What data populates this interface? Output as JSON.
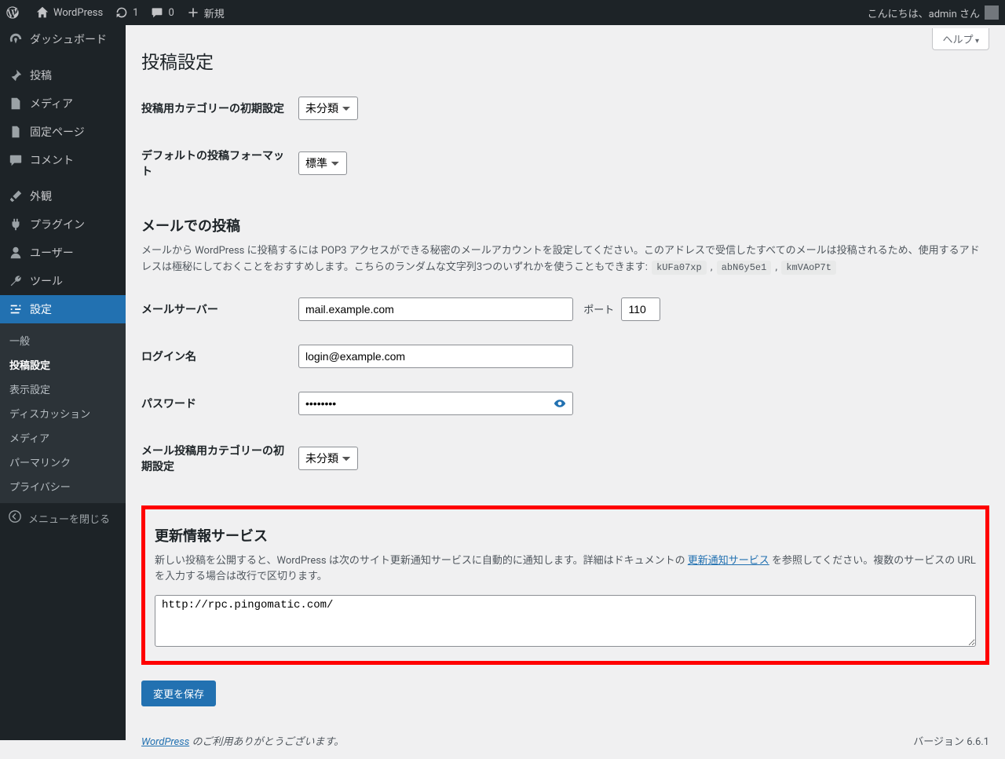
{
  "adminbar": {
    "site_name": "WordPress",
    "updates_count": "1",
    "comments_count": "0",
    "new_label": "新規",
    "greeting": "こんにちは、admin さん"
  },
  "sidebar": {
    "items": [
      {
        "label": "ダッシュボード"
      },
      {
        "label": "投稿"
      },
      {
        "label": "メディア"
      },
      {
        "label": "固定ページ"
      },
      {
        "label": "コメント"
      },
      {
        "label": "外観"
      },
      {
        "label": "プラグイン"
      },
      {
        "label": "ユーザー"
      },
      {
        "label": "ツール"
      },
      {
        "label": "設定"
      }
    ],
    "submenu": [
      {
        "label": "一般"
      },
      {
        "label": "投稿設定"
      },
      {
        "label": "表示設定"
      },
      {
        "label": "ディスカッション"
      },
      {
        "label": "メディア"
      },
      {
        "label": "パーマリンク"
      },
      {
        "label": "プライバシー"
      }
    ],
    "collapse_label": "メニューを閉じる"
  },
  "help_label": "ヘルプ",
  "page_title": "投稿設定",
  "fields": {
    "default_category_label": "投稿用カテゴリーの初期設定",
    "default_category_value": "未分類",
    "default_format_label": "デフォルトの投稿フォーマット",
    "default_format_value": "標準"
  },
  "mail": {
    "heading": "メールでの投稿",
    "desc_prefix": "メールから WordPress に投稿するには POP3 アクセスができる秘密のメールアカウントを設定してください。このアドレスで受信したすべてのメールは投稿されるため、使用するアドレスは極秘にしておくことをおすすめします。こちらのランダムな文字列3つのいずれかを使うこともできます: ",
    "random1": "kUFa07xp",
    "random2": "abN6y5e1",
    "random3": "kmVAoP7t",
    "server_label": "メールサーバー",
    "server_value": "mail.example.com",
    "port_label": "ポート",
    "port_value": "110",
    "login_label": "ログイン名",
    "login_value": "login@example.com",
    "password_label": "パスワード",
    "password_value": "password",
    "mail_category_label": "メール投稿用カテゴリーの初期設定",
    "mail_category_value": "未分類"
  },
  "update_services": {
    "heading": "更新情報サービス",
    "desc_prefix": "新しい投稿を公開すると、WordPress は次のサイト更新通知サービスに自動的に通知します。詳細はドキュメントの ",
    "link_text": "更新通知サービス",
    "desc_suffix": " を参照してください。複数のサービスの URL を入力する場合は改行で区切ります。",
    "value": "http://rpc.pingomatic.com/"
  },
  "save_label": "変更を保存",
  "footer": {
    "thanks_prefix": "",
    "link": "WordPress",
    "thanks_suffix": " のご利用ありがとうございます。",
    "version": "バージョン 6.6.1"
  }
}
